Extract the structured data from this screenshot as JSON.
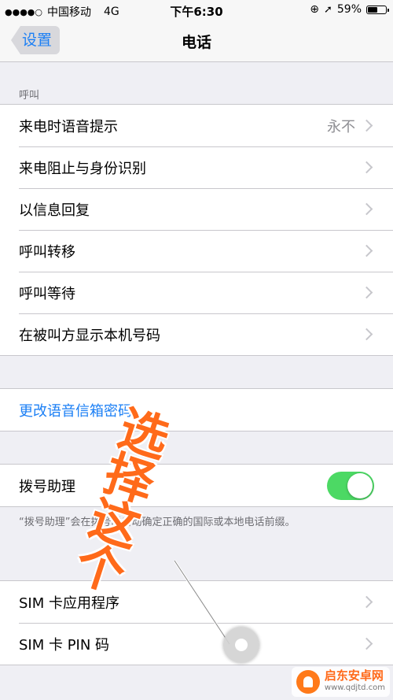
{
  "status_bar": {
    "carrier": "中国移动",
    "network": "4G",
    "time": "下午6:30",
    "battery_percent": "59%",
    "battery_level": 0.59
  },
  "nav": {
    "back_label": "设置",
    "title": "电话"
  },
  "sections": {
    "call_header": "呼叫",
    "call_items": [
      {
        "label": "来电时语音提示",
        "value": "永不"
      },
      {
        "label": "来电阻止与身份识别"
      },
      {
        "label": "以信息回复"
      },
      {
        "label": "呼叫转移"
      },
      {
        "label": "呼叫等待"
      },
      {
        "label": "在被叫方显示本机号码"
      }
    ],
    "voicemail_link": "更改语音信箱密码",
    "dial_assist": {
      "label": "拨号助理",
      "enabled": true,
      "footnote": "“拨号助理”会在拨号时自动确定正确的国际或本地电话前缀。"
    },
    "sim_items": [
      {
        "label": "SIM 卡应用程序"
      },
      {
        "label": "SIM 卡 PIN 码"
      }
    ]
  },
  "annotation": {
    "text": "选择这个",
    "color": "#ff6a1a"
  },
  "watermark": {
    "title": "启东安卓网",
    "url": "www.qdjtd.com"
  },
  "colors": {
    "accent": "#1b7ff5",
    "toggle_on": "#4cd964",
    "background": "#efeff4"
  }
}
